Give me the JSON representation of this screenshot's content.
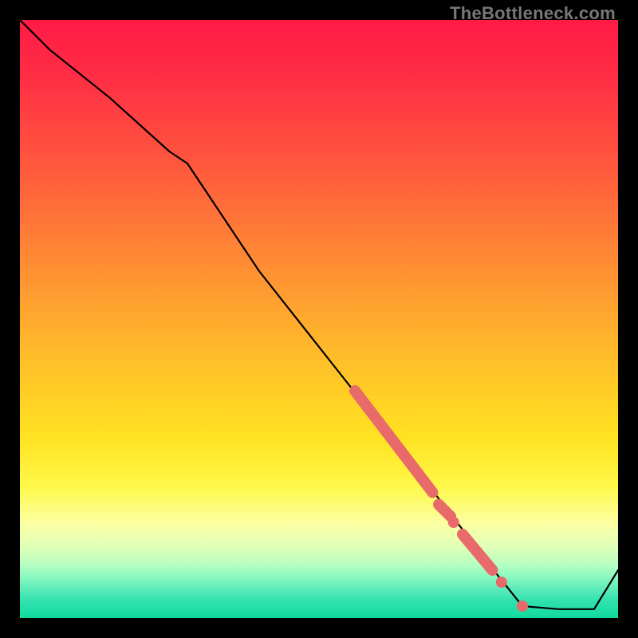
{
  "watermark": "TheBottleneck.com",
  "colors": {
    "line": "#000000",
    "highlight": "#e86a6a",
    "frame_bg": "#000000"
  },
  "chart_data": {
    "type": "line",
    "title": "",
    "xlabel": "",
    "ylabel": "",
    "xlim": [
      0,
      100
    ],
    "ylim": [
      0,
      100
    ],
    "grid": false,
    "legend": false,
    "series": [
      {
        "name": "curve",
        "x": [
          0,
          5,
          15,
          25,
          28,
          40,
          55,
          70,
          80,
          84,
          90,
          96,
          100
        ],
        "y": [
          100,
          95,
          87,
          78,
          76,
          58,
          39,
          20,
          7,
          2,
          1.5,
          1.5,
          8
        ]
      }
    ],
    "highlight_segments": [
      {
        "x": [
          56,
          69
        ],
        "y": [
          38,
          21
        ]
      },
      {
        "x": [
          70,
          72
        ],
        "y": [
          19,
          17
        ]
      },
      {
        "x": [
          74,
          79
        ],
        "y": [
          14,
          8
        ]
      }
    ],
    "highlight_points": [
      {
        "x": 72.5,
        "y": 16
      },
      {
        "x": 80.5,
        "y": 6
      },
      {
        "x": 84.0,
        "y": 2
      }
    ]
  }
}
